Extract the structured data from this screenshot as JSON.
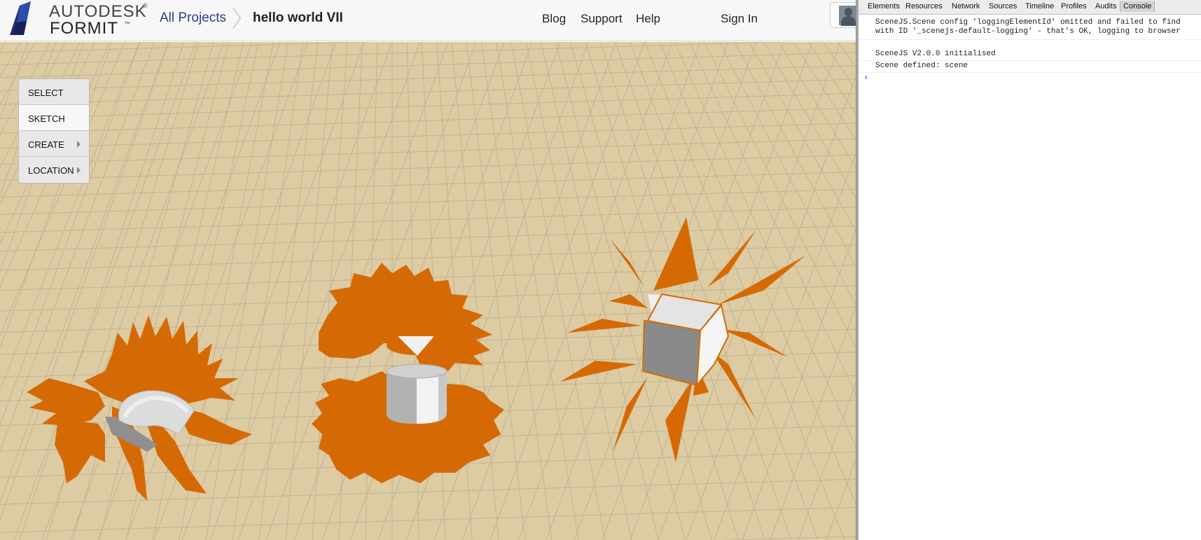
{
  "header": {
    "logo_line1": "AUTODESK",
    "logo_line2": "FORMIT",
    "breadcrumb_root": "All Projects",
    "project_name": "hello world VII",
    "nav": {
      "blog": "Blog",
      "support": "Support",
      "help": "Help",
      "sign_in": "Sign In"
    }
  },
  "tools": [
    {
      "label": "SELECT",
      "has_submenu": false
    },
    {
      "label": "SKETCH",
      "has_submenu": false,
      "active": true
    },
    {
      "label": "CREATE",
      "has_submenu": true
    },
    {
      "label": "LOCATION",
      "has_submenu": true
    }
  ],
  "devtools": {
    "tabs": [
      "Elements",
      "Resources",
      "Network",
      "Sources",
      "Timeline",
      "Profiles",
      "Audits",
      "Console"
    ],
    "selected_tab": "Console",
    "console_lines": [
      "SceneJS.Scene config 'loggingElementId' omitted and failed to find",
      "with ID '_scenejs-default-logging' - that's OK, logging to browser",
      "SceneJS V2.0.0 initialised",
      "Scene defined: scene"
    ],
    "prompt_symbol": "›"
  },
  "colors": {
    "ground": "#dccba3",
    "grid": "#c3b392",
    "accent_orange": "#d56a05",
    "brand_navy": "#1d2c6e"
  },
  "icons": {
    "logo": "autodesk-logo-icon",
    "breadcrumb_separator": "chevron-right-icon",
    "avatar": "user-avatar-icon",
    "submenu": "triangle-right-icon"
  }
}
